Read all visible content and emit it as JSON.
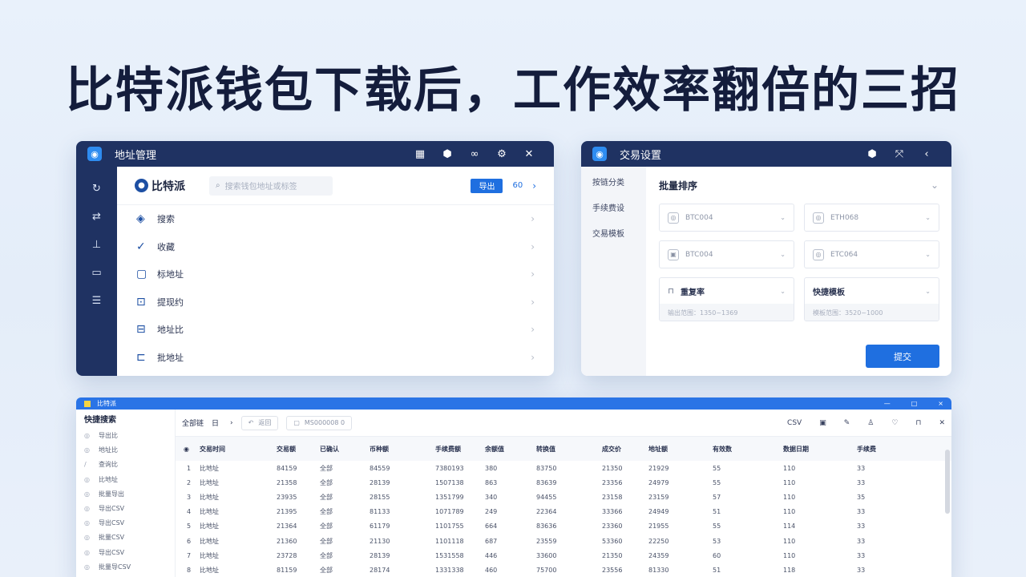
{
  "headline": "比特派钱包下载后，工作效率翻倍的三招",
  "window1": {
    "title": "地址管理",
    "titlebar_icons": [
      "grid-icon",
      "shield-icon",
      "link-icon",
      "settings-icon",
      "close-icon"
    ],
    "sidebar_icons": [
      "refresh-icon",
      "shuffle-icon",
      "tool-icon",
      "card-icon",
      "list-icon"
    ],
    "brand": "比特派",
    "search_placeholder": "搜索钱包地址或标签",
    "action_button": "导出",
    "action_extra": "60",
    "items": [
      {
        "icon": "tag-icon",
        "label": "搜索"
      },
      {
        "icon": "check-icon",
        "label": "收藏"
      },
      {
        "icon": "doc-icon",
        "label": "标地址"
      },
      {
        "icon": "key-icon",
        "label": "提现约"
      },
      {
        "icon": "folder-icon",
        "label": "地址比"
      },
      {
        "icon": "archive-icon",
        "label": "批地址"
      }
    ]
  },
  "window2": {
    "title": "交易设置",
    "titlebar_icons": [
      "shield-icon",
      "expand-icon",
      "back-icon"
    ],
    "sidebar": [
      "按链分类",
      "手续费设",
      "交易模板"
    ],
    "section_title": "批量排序",
    "selects": [
      {
        "icon": "coin-icon",
        "value": "BTC004"
      },
      {
        "icon": "coin-icon",
        "value": "ETH068"
      },
      {
        "icon": "image-icon",
        "value": "BTC004"
      },
      {
        "icon": "coin-icon",
        "value": "ETC064"
      }
    ],
    "fields": [
      {
        "icon": "lock-icon",
        "label": "重复率",
        "hint": "输出范围：1350~1369"
      },
      {
        "label": "快捷模板",
        "hint": "模板范围：3520~1000"
      }
    ],
    "submit": "提交"
  },
  "window3": {
    "title": "比特派",
    "titlebar_buttons": [
      "—",
      "□",
      "×"
    ],
    "sidebar_title": "快捷搜索",
    "sidebar_items": [
      "导出比",
      "地址比",
      "查询比",
      "比地址",
      "批量导出",
      "导出CSV",
      "导出CSV",
      "批量CSV",
      "导出CSV",
      "批量导CSV"
    ],
    "toolbar": {
      "label": "全部链",
      "tag": "日",
      "back": "返回",
      "filter": "MS000008 0"
    },
    "toolbar_icons": [
      "csv-label",
      "save-icon",
      "edit-icon",
      "user-icon",
      "heart-icon",
      "lock-icon",
      "close-icon"
    ],
    "toolbar_csv": "CSV",
    "columns": [
      "交易时间",
      "交易额",
      "已确认",
      "币种额",
      "手续费额",
      "余额值",
      "转换值",
      "成交价",
      "地址额",
      "有效数",
      "数据日期",
      "手续费"
    ],
    "rows": [
      [
        "1",
        "比地址",
        "84159",
        "全部",
        "84559",
        "7380193",
        "380",
        "83750",
        "21350",
        "21929",
        "55",
        "110",
        "33"
      ],
      [
        "2",
        "比地址",
        "21358",
        "全部",
        "28139",
        "1507138",
        "863",
        "83639",
        "23356",
        "24979",
        "55",
        "110",
        "33"
      ],
      [
        "3",
        "比地址",
        "23935",
        "全部",
        "28155",
        "1351799",
        "340",
        "94455",
        "23158",
        "23159",
        "57",
        "110",
        "35"
      ],
      [
        "4",
        "比地址",
        "21395",
        "全部",
        "81133",
        "1071789",
        "249",
        "22364",
        "33366",
        "24949",
        "51",
        "110",
        "33"
      ],
      [
        "5",
        "比地址",
        "21364",
        "全部",
        "61179",
        "1101755",
        "664",
        "83636",
        "23360",
        "21955",
        "55",
        "114",
        "33"
      ],
      [
        "6",
        "比地址",
        "21360",
        "全部",
        "21130",
        "1101118",
        "687",
        "23559",
        "53360",
        "22250",
        "53",
        "110",
        "33"
      ],
      [
        "7",
        "比地址",
        "23728",
        "全部",
        "28139",
        "1531558",
        "446",
        "33600",
        "21350",
        "24359",
        "60",
        "110",
        "33"
      ],
      [
        "8",
        "比地址",
        "81159",
        "全部",
        "28174",
        "1331338",
        "460",
        "75700",
        "23556",
        "81330",
        "51",
        "118",
        "33"
      ]
    ]
  }
}
